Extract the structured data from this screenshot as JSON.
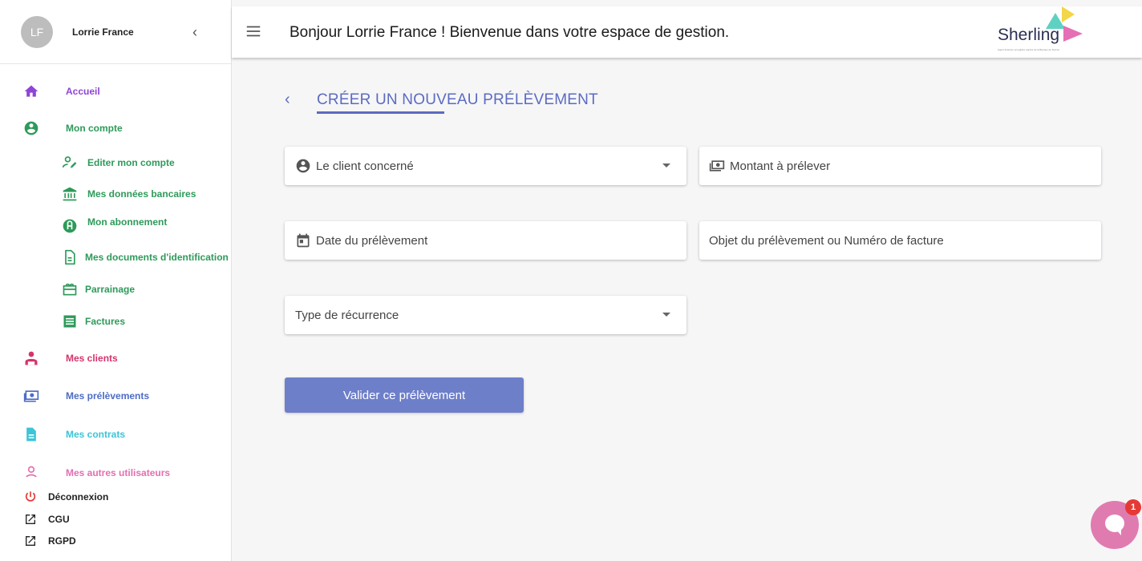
{
  "user": {
    "initials": "LF",
    "name": "Lorrie France"
  },
  "header": {
    "welcome": "Bonjour Lorrie France ! Bienvenue dans votre espace de gestion."
  },
  "logo": {
    "text": "Sherling",
    "tagline": "Agent financier enregistré auprès de la Banque de France"
  },
  "sidebar": {
    "items": [
      {
        "label": "Accueil",
        "icon": "home-icon",
        "color": "#8e44d6"
      },
      {
        "label": "Mon compte",
        "icon": "account-circle-icon",
        "color": "#2e9a5a"
      },
      {
        "label": "Editer mon compte",
        "icon": "edit-account-icon",
        "color": "#2e9a5a"
      },
      {
        "label": "Mes données bancaires",
        "icon": "bank-icon",
        "color": "#2e9a5a"
      },
      {
        "label": "Mon abonnement",
        "icon": "subscription-icon",
        "color": "#2e9a5a"
      },
      {
        "label": "Mes documents d'identification",
        "icon": "document-icon",
        "color": "#2e9a5a"
      },
      {
        "label": "Parrainage",
        "icon": "gift-icon",
        "color": "#2e9a5a"
      },
      {
        "label": "Factures",
        "icon": "invoice-icon",
        "color": "#2e9a5a"
      },
      {
        "label": "Mes clients",
        "icon": "clients-icon",
        "color": "#d6336c"
      },
      {
        "label": "Mes prélèvements",
        "icon": "money-icon",
        "color": "#4d6cc4"
      },
      {
        "label": "Mes contrats",
        "icon": "contract-icon",
        "color": "#3cc4d8"
      },
      {
        "label": "Mes autres utilisateurs",
        "icon": "users-icon",
        "color": "#e36fb0"
      }
    ],
    "footer": [
      {
        "label": "Déconnexion",
        "icon": "power-icon"
      },
      {
        "label": "CGU",
        "icon": "external-link-icon"
      },
      {
        "label": "RGPD",
        "icon": "external-link-icon"
      }
    ]
  },
  "form": {
    "title": "CRÉER UN NOUVEAU PRÉLÈVEMENT",
    "client_placeholder": "Le client concerné",
    "amount_placeholder": "Montant à prélever",
    "date_placeholder": "Date du prélèvement",
    "object_placeholder": "Objet du prélèvement ou Numéro de facture",
    "recurrence_placeholder": "Type de récurrence",
    "submit_label": "Valider ce prélèvement"
  },
  "chat": {
    "unread": "1"
  },
  "colors": {
    "accent": "#5c6bc0",
    "button": "#6e7fc9",
    "chat": "#e07bb0",
    "badge": "#e53935"
  }
}
